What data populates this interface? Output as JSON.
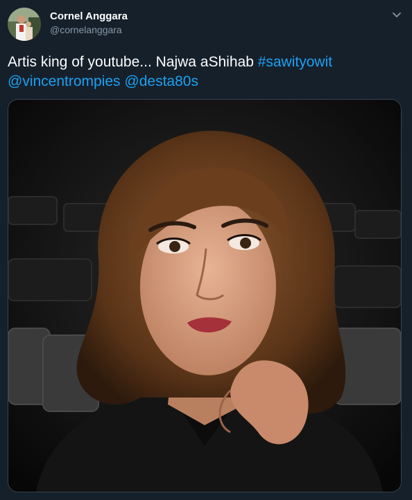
{
  "tweet": {
    "author_name": "Cornel Anggara",
    "author_handle": "@cornelanggara",
    "menu_icon": "chevron-down-icon",
    "text_plain": "Artis king of youtube... Najwa aShihab ",
    "hashtag": "#sawityowit",
    "mention_1": "@vincentrompies",
    "mention_2": "@desta80s",
    "link_color": "#1da1f2",
    "background_color": "#15202b"
  }
}
